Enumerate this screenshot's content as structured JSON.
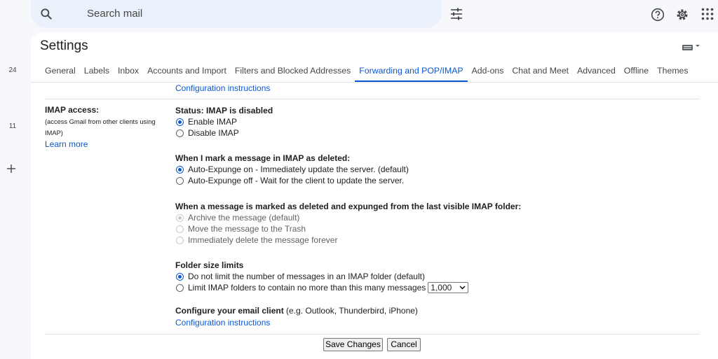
{
  "search": {
    "placeholder": "Search mail"
  },
  "left_rail": {
    "count_1": "24",
    "count_2": "11"
  },
  "settings": {
    "title": "Settings",
    "tabs": [
      "General",
      "Labels",
      "Inbox",
      "Accounts and Import",
      "Filters and Blocked Addresses",
      "Forwarding and POP/IMAP",
      "Add-ons",
      "Chat and Meet",
      "Advanced",
      "Offline",
      "Themes"
    ],
    "active_tab": "Forwarding and POP/IMAP",
    "config_link_top": "Configuration instructions"
  },
  "imap": {
    "label": "IMAP access:",
    "sub_line1": "(access Gmail from other clients using",
    "sub_line2": "IMAP)",
    "learn_more": "Learn more",
    "status": "Status: IMAP is disabled",
    "enable": "Enable IMAP",
    "disable": "Disable IMAP",
    "enable_selected": true,
    "deleted_heading": "When I mark a message in IMAP as deleted:",
    "expunge_on": "Auto-Expunge on - Immediately update the server. (default)",
    "expunge_off": "Auto-Expunge off - Wait for the client to update the server.",
    "expunge_on_selected": true,
    "expunged_heading": "When a message is marked as deleted and expunged from the last visible IMAP folder:",
    "archive": "Archive the message (default)",
    "trash": "Move the message to the Trash",
    "delete_forever": "Immediately delete the message forever",
    "folder_heading": "Folder size limits",
    "no_limit": "Do not limit the number of messages in an IMAP folder (default)",
    "limit": "Limit IMAP folders to contain no more than this many messages",
    "limit_value": "1,000",
    "client_heading": "Configure your email client",
    "client_note": " (e.g. Outlook, Thunderbird, iPhone)",
    "config_link": "Configuration instructions"
  },
  "buttons": {
    "save": "Save Changes",
    "cancel": "Cancel"
  },
  "colors": {
    "accent": "#0b57d0",
    "background": "#f6f8fc",
    "search_bg": "#eaf1fb"
  },
  "icons": [
    "search-icon",
    "tune-icon",
    "help-icon",
    "gear-icon",
    "apps-icon",
    "keyboard-icon",
    "plus-icon",
    "chevron-down-icon"
  ]
}
